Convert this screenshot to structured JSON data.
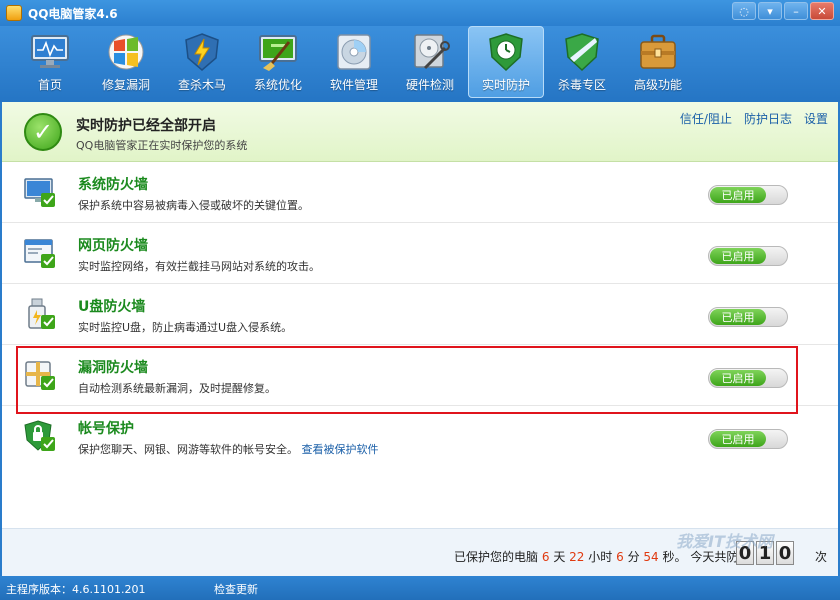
{
  "window": {
    "title": "QQ电脑管家4.6"
  },
  "toolbar": {
    "items": [
      {
        "label": "首页",
        "icon": "home-monitor-icon"
      },
      {
        "label": "修复漏洞",
        "icon": "windows-shield-icon"
      },
      {
        "label": "查杀木马",
        "icon": "lightning-shield-icon"
      },
      {
        "label": "系统优化",
        "icon": "broom-monitor-icon"
      },
      {
        "label": "软件管理",
        "icon": "disc-box-icon"
      },
      {
        "label": "硬件检测",
        "icon": "hardware-tool-icon"
      },
      {
        "label": "实时防护",
        "icon": "clock-shield-icon"
      },
      {
        "label": "杀毒专区",
        "icon": "stripe-shield-icon"
      },
      {
        "label": "高级功能",
        "icon": "toolbox-icon"
      }
    ],
    "active_index": 6
  },
  "status": {
    "title": "实时防护已经全部开启",
    "subtitle": "QQ电脑管家正在实时保护您的系统",
    "links": [
      "信任/阻止",
      "防护日志",
      "设置"
    ]
  },
  "firewalls": [
    {
      "name": "系统防火墙",
      "desc": "保护系统中容易被病毒入侵或破坏的关键位置。",
      "toggle": "已启用"
    },
    {
      "name": "网页防火墙",
      "desc": "实时监控网络，有效拦截挂马网站对系统的攻击。",
      "toggle": "已启用"
    },
    {
      "name": "U盘防火墙",
      "desc": "实时监控U盘，防止病毒通过U盘入侵系统。",
      "toggle": "已启用"
    },
    {
      "name": "漏洞防火墙",
      "desc": "自动检测系统最新漏洞，及时提醒修复。",
      "toggle": "已启用"
    },
    {
      "name": "帐号保护",
      "desc": "保护您聊天、网银、网游等软件的帐号安全。",
      "link": "查看被保护软件",
      "toggle": "已启用"
    }
  ],
  "protection": {
    "prefix": "已保护您的电脑",
    "days": "6",
    "days_unit": "天",
    "hours": "22",
    "hours_unit": "小时",
    "minutes": "6",
    "minutes_unit": "分",
    "seconds": "54",
    "seconds_unit": "秒。",
    "today_label": "今天共防护",
    "today_digits": [
      "0",
      "1",
      "0"
    ],
    "today_unit": "次"
  },
  "footer": {
    "version": "主程序版本：4.6.1101.201",
    "check_update": "检查更新"
  },
  "watermark": "我爱IT技术网",
  "colors": {
    "accent_blue": "#2a7ccb",
    "title_green": "#1b8a1e",
    "toggle_green": "#3ea51a",
    "highlight_red": "#e0141c",
    "number_red": "#e03a10"
  }
}
